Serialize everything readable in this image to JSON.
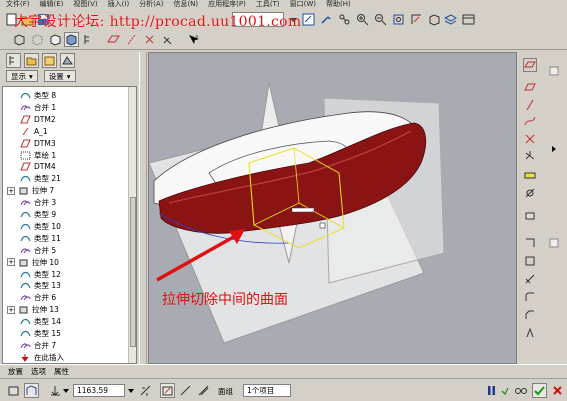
{
  "menu": [
    "文件(F)",
    "编辑(E)",
    "视图(V)",
    "插入(I)",
    "分析(A)",
    "信息(N)",
    "应用程序(P)",
    "工具(T)",
    "窗口(W)",
    "帮助(H)"
  ],
  "watermark": "大宇设计论坛: http://procad.uu1001.com",
  "tree_header": {
    "show_label": "显示",
    "settings_label": "设置"
  },
  "tree_items": [
    {
      "label": "类型 8",
      "icon": "surface-icon",
      "expandable": false,
      "indent": 1
    },
    {
      "label": "合并 1",
      "icon": "merge-icon",
      "expandable": false,
      "indent": 1
    },
    {
      "label": "DTM2",
      "icon": "datum-plane-icon",
      "expandable": false,
      "indent": 1
    },
    {
      "label": "A_1",
      "icon": "axis-icon",
      "expandable": false,
      "indent": 1
    },
    {
      "label": "DTM3",
      "icon": "datum-plane-icon",
      "expandable": false,
      "indent": 1
    },
    {
      "label": "草绘 1",
      "icon": "sketch-icon",
      "expandable": false,
      "indent": 1
    },
    {
      "label": "DTM4",
      "icon": "datum-plane-icon",
      "expandable": false,
      "indent": 1
    },
    {
      "label": "类型 21",
      "icon": "surface-icon",
      "expandable": false,
      "indent": 1
    },
    {
      "label": "拉伸 7",
      "icon": "extrude-icon",
      "expandable": true,
      "indent": 0
    },
    {
      "label": "合并 3",
      "icon": "merge-icon",
      "expandable": false,
      "indent": 1
    },
    {
      "label": "类型 9",
      "icon": "surface-icon",
      "expandable": false,
      "indent": 1
    },
    {
      "label": "类型 10",
      "icon": "surface-icon",
      "expandable": false,
      "indent": 1
    },
    {
      "label": "类型 11",
      "icon": "surface-icon",
      "expandable": false,
      "indent": 1
    },
    {
      "label": "合并 5",
      "icon": "merge-icon",
      "expandable": false,
      "indent": 1
    },
    {
      "label": "拉伸 10",
      "icon": "extrude-icon",
      "expandable": true,
      "indent": 0
    },
    {
      "label": "类型 12",
      "icon": "surface-icon",
      "expandable": false,
      "indent": 1
    },
    {
      "label": "类型 13",
      "icon": "surface-icon",
      "expandable": false,
      "indent": 1
    },
    {
      "label": "合并 6",
      "icon": "merge-icon",
      "expandable": false,
      "indent": 1
    },
    {
      "label": "拉伸 13",
      "icon": "extrude-icon",
      "expandable": true,
      "indent": 0
    },
    {
      "label": "类型 14",
      "icon": "surface-icon",
      "expandable": false,
      "indent": 1
    },
    {
      "label": "类型 15",
      "icon": "surface-icon",
      "expandable": false,
      "indent": 1
    },
    {
      "label": "合并 7",
      "icon": "merge-icon",
      "expandable": false,
      "indent": 1
    },
    {
      "label": "在此插入",
      "icon": "insert-here-icon",
      "expandable": false,
      "indent": 1
    }
  ],
  "annotation": "拉伸切除中间的曲面",
  "dashboard": {
    "tabs": [
      "放置",
      "选项",
      "属性"
    ],
    "depth_value": "1163.59",
    "surface_group_label": "面组",
    "surface_group_value": "1个项目"
  },
  "colors": {
    "accent_red": "#e01010",
    "car_body": "#8a1414",
    "viewport_bg": "#a8abb2"
  }
}
